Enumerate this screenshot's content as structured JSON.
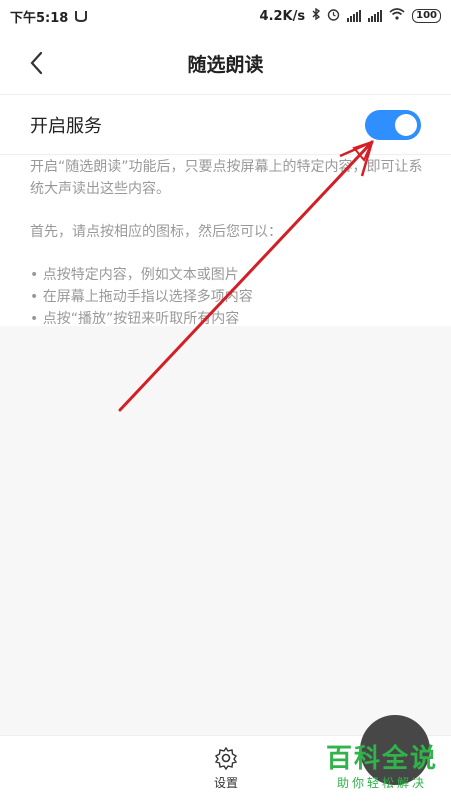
{
  "status_bar": {
    "time": "下午5:18",
    "speed": "4.2K/s",
    "battery": "100"
  },
  "header": {
    "title": "随选朗读"
  },
  "service": {
    "label": "开启服务",
    "enabled": true
  },
  "description": {
    "lines": [
      "开启“随选朗读”功能后，只要点按屏幕上的特定内容，即可让系统大声读出这些内容。",
      "首先，请点按相应的图标，然后您可以：",
      "• 点按特定内容，例如文本或图片",
      "• 在屏幕上拖动手指以选择多项内容",
      "• 点按“播放”按钮来听取所有内容"
    ]
  },
  "bottom_bar": {
    "settings_label": "设置"
  },
  "watermark": {
    "main": "百科全说",
    "sub": "助你轻松解决"
  },
  "colors": {
    "toggle": "#2f8fff",
    "watermark": "#2fb34a",
    "arrow": "#d41f26"
  }
}
